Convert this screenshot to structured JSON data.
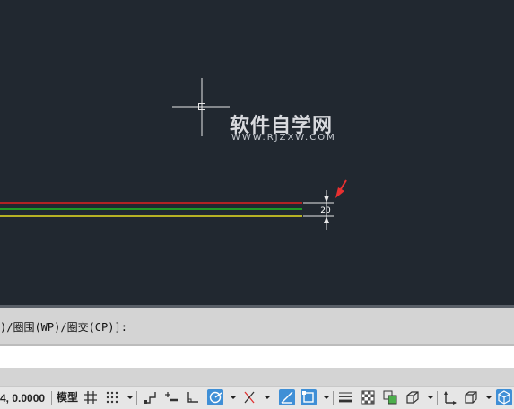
{
  "canvas": {
    "background_color": "#212830",
    "dimension_value": "20",
    "lines": [
      {
        "color": "#e02020"
      },
      {
        "color": "#20c020"
      },
      {
        "color": "#e8e020"
      }
    ],
    "arrow_color": "#e83030"
  },
  "watermark": {
    "title": "软件自学网",
    "url": "WWW.RJZXW.COM"
  },
  "command_line": {
    "history": ")/圈围(WP)/圈交(CP)]:",
    "input_value": ""
  },
  "status_bar": {
    "coordinates": "4, 0.0000",
    "model_label": "模型",
    "accent_color": "#3f8fd6",
    "icons": [
      "grid-icon",
      "snap-icon",
      "infer-constraints-icon",
      "dynamic-input-icon",
      "ortho-icon",
      "polar-tracking-icon",
      "isometric-drafting-icon",
      "object-snap-tracking-icon",
      "object-snap-icon",
      "lineweight-icon",
      "transparency-icon",
      "selection-cycling-icon",
      "3d-object-snap-icon",
      "dynamic-ucs-icon",
      "selection-filter-icon",
      "gizmo-icon"
    ]
  }
}
